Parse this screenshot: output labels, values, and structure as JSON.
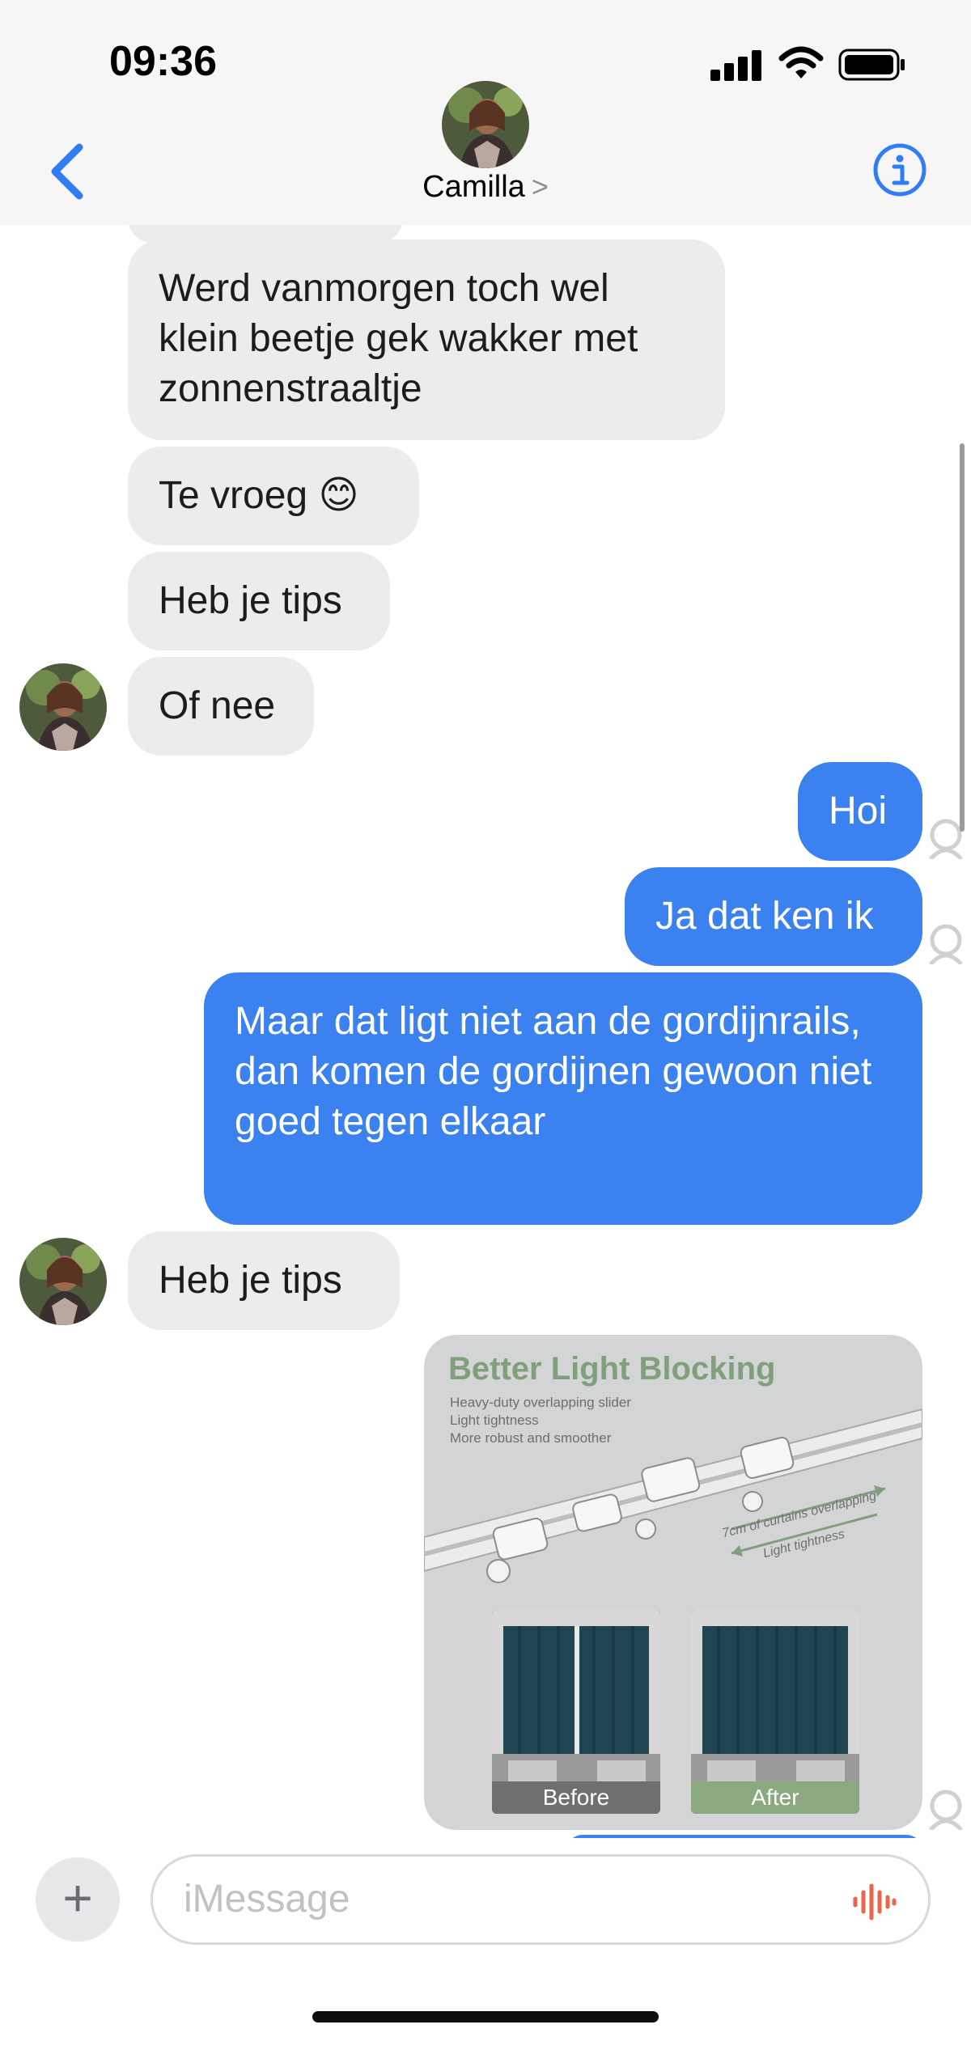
{
  "status_bar": {
    "time": "09:36"
  },
  "header": {
    "contact_name": "Camilla",
    "chevron": ">"
  },
  "messages": [
    {
      "dir": "in",
      "text": "Werd vanmorgen toch wel klein beetje gek wakker met zonnenstraaltje"
    },
    {
      "dir": "in",
      "text": "Te vroeg 😊"
    },
    {
      "dir": "in",
      "text": "Heb je tips"
    },
    {
      "dir": "in",
      "text": "Of nee"
    },
    {
      "dir": "out",
      "text": "Hoi"
    },
    {
      "dir": "out",
      "text": "Ja dat ken ik"
    },
    {
      "dir": "out",
      "text": "Maar dat ligt niet aan de gordijnrails, dan komen de gordijnen gewoon niet goed tegen elkaar"
    },
    {
      "dir": "in",
      "text": "Heb je tips"
    }
  ],
  "image_attachment": {
    "title": "Better Light Blocking",
    "lines": [
      "Heavy-duty overlapping slider",
      "Light tightness",
      "More robust and smoother"
    ],
    "overlap_caption": "7cm of curtains overlapping",
    "light_caption": "Light tightness",
    "before_label": "Before",
    "after_label": "After"
  },
  "composer": {
    "placeholder": "iMessage",
    "add_symbol": "+"
  },
  "colors": {
    "outgoing": "#3b82f0",
    "incoming": "#ececec",
    "accent": "#2f7cf6"
  },
  "icons": [
    "back-chevron-icon",
    "info-icon",
    "signal-icon",
    "wifi-icon",
    "battery-icon",
    "audio-waveform-icon",
    "read-receipt-icon"
  ]
}
